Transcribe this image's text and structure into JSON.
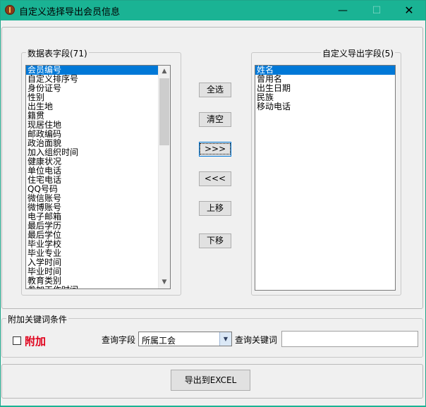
{
  "window": {
    "title": "自定义选择导出会员信息",
    "minimize": "—",
    "maximize": "☐",
    "close": "✕"
  },
  "source_group": {
    "label": "数据表字段(71)",
    "items": [
      "会员编号",
      "自定义排序号",
      "身份证号",
      "性别",
      "出生地",
      "籍贯",
      "现居住地",
      "邮政编码",
      "政治面貌",
      "加入组织时间",
      "健康状况",
      "单位电话",
      "住宅电话",
      "QQ号码",
      "微信账号",
      "微博账号",
      "电子邮箱",
      "最后学历",
      "最后学位",
      "毕业学校",
      "毕业专业",
      "入学时间",
      "毕业时间",
      "教育类别",
      "参加工作时间"
    ],
    "selected_index": 0
  },
  "target_group": {
    "label": "自定义导出字段(5)",
    "items": [
      "姓名",
      "曾用名",
      "出生日期",
      "民族",
      "移动电话"
    ],
    "selected_index": 0
  },
  "buttons": {
    "select_all": "全选",
    "clear": "清空",
    "move_right": ">>>",
    "move_left": "<<<",
    "move_up": "上移",
    "move_down": "下移",
    "export": "导出到EXCEL"
  },
  "filter": {
    "group_label": "附加关键词条件",
    "attach_label": "附加",
    "attach_checked": false,
    "query_field_label": "查询字段",
    "query_field_value": "所属工会",
    "keyword_label": "查询关键词",
    "keyword_value": ""
  },
  "colors": {
    "titlebar": "#1ab394",
    "selection": "#0078d7",
    "attach_text": "#e0001b"
  }
}
